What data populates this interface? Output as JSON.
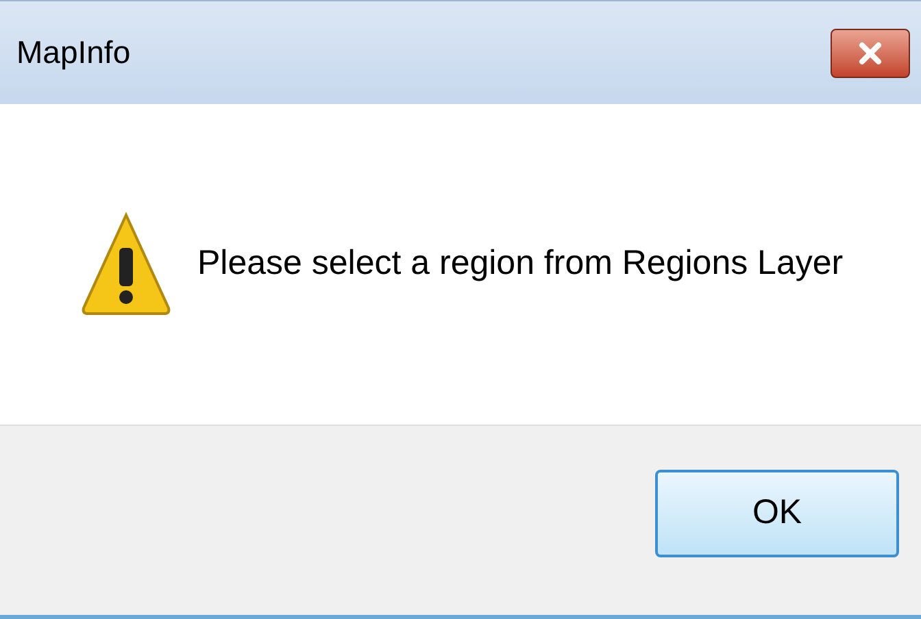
{
  "window": {
    "title": "MapInfo"
  },
  "message": "Please select a region from Regions Layer",
  "buttons": [
    {
      "label": "OK"
    }
  ]
}
